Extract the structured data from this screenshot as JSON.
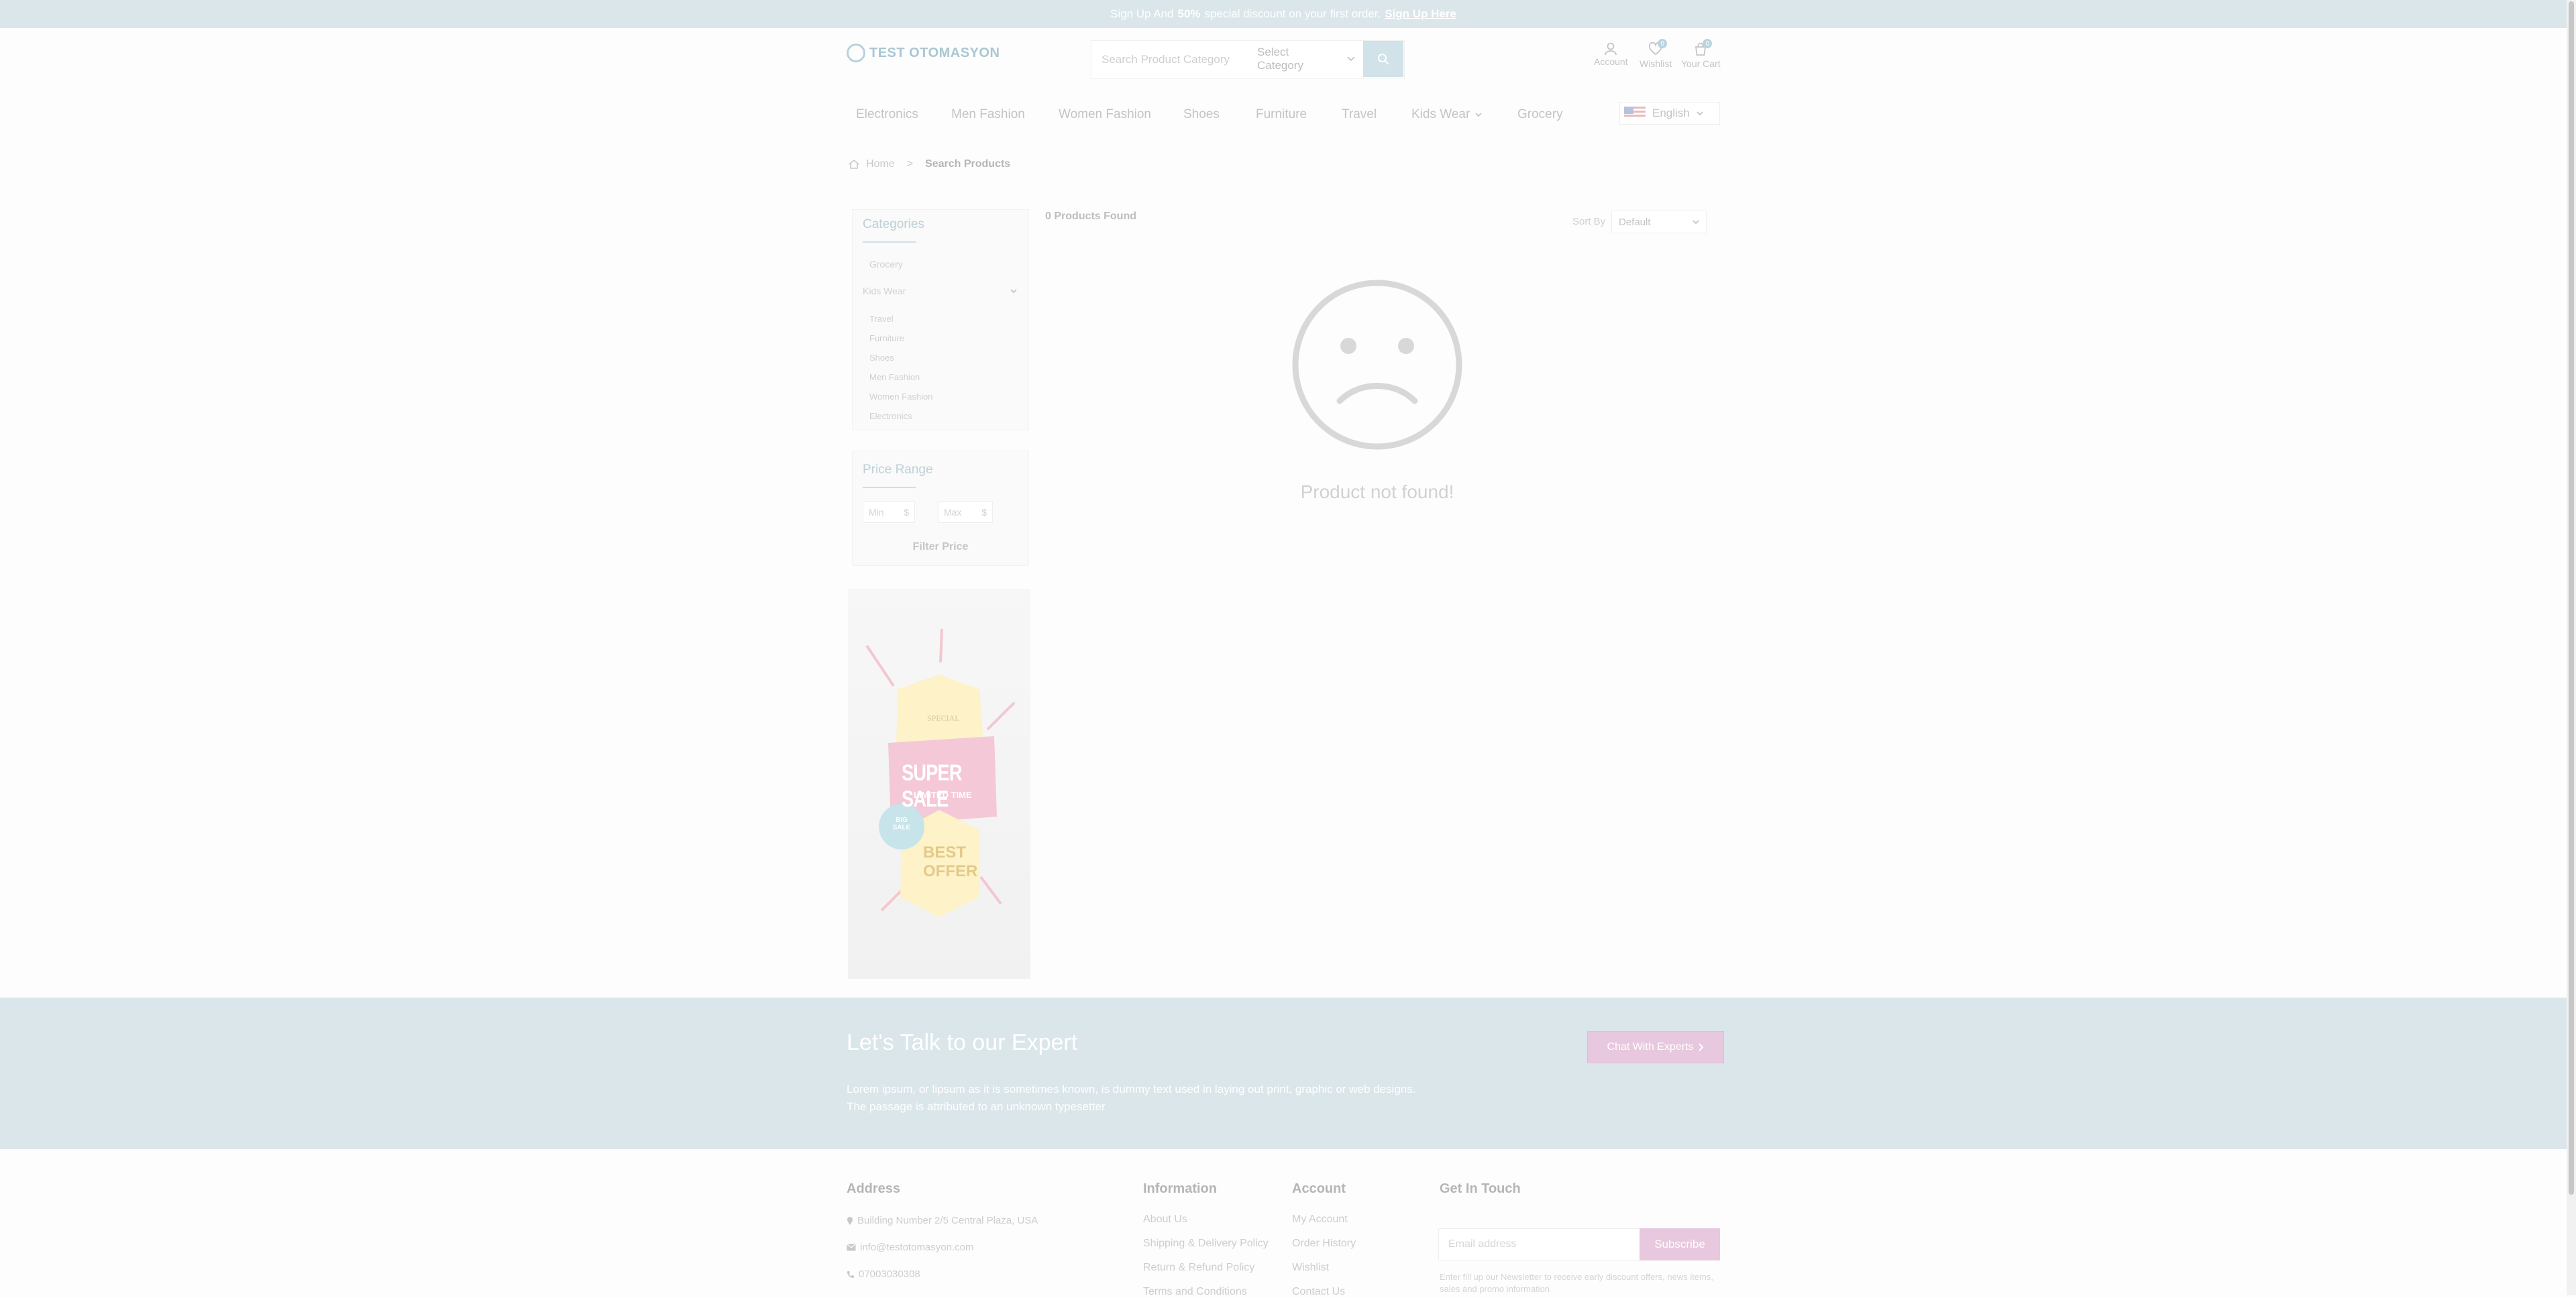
{
  "topbar": {
    "text_before": "Sign Up And",
    "discount": "50%",
    "text_after": "special discount on your first order.",
    "link": "Sign Up Here"
  },
  "header": {
    "logo_text": "TEST OTOMASYON",
    "search_placeholder": "Search Product Category",
    "category_select": "Select Category",
    "account_label": "Account",
    "wishlist_label": "Wishlist",
    "wishlist_count": "0",
    "cart_label": "Your Cart",
    "cart_count": "0"
  },
  "nav": {
    "items": [
      "Electronics",
      "Men Fashion",
      "Women Fashion",
      "Shoes",
      "Furniture",
      "Travel",
      "Kids Wear",
      "Grocery"
    ],
    "language": "English"
  },
  "breadcrumb": {
    "home": "Home",
    "separator": ">",
    "current": "Search Products"
  },
  "sidebar": {
    "categories_title": "Categories",
    "categories": [
      "Grocery",
      "Kids Wear",
      "Travel",
      "Furniture",
      "Shoes",
      "Men Fashion",
      "Women Fashion",
      "Electronics"
    ],
    "price_title": "Price Range",
    "min_label": "Min",
    "max_label": "Max",
    "currency": "$",
    "filter_button": "Filter Price"
  },
  "banner": {
    "top_text": "SPECIAL",
    "sale_text": "SUPER SALE",
    "limited_text": "LIMITED TIME",
    "offer_text": "BEST OFFER",
    "badge_text": "BIG SALE"
  },
  "results": {
    "count_text": "0 Products Found",
    "sort_label": "Sort By",
    "sort_value": "Default",
    "empty_message": "Product not found!"
  },
  "expert": {
    "title": "Let's Talk to our Expert",
    "text": "Lorem ipsum, or lipsum as it is sometimes known, is dummy text used in laying out print, graphic or web designs. The passage is attributed to an unknown typesetter",
    "button": "Chat With Experts"
  },
  "footer": {
    "address_title": "Address",
    "address": "Building Number 2/5 Central Plaza, USA",
    "email": "info@testotomasyon.com",
    "phone": "07003030308",
    "information_title": "Information",
    "information_links": [
      "About Us",
      "Shipping & Delivery Policy",
      "Return & Refund Policy",
      "Terms and Conditions"
    ],
    "account_title": "Account",
    "account_links": [
      "My Account",
      "Order History",
      "Wishlist",
      "Contact Us"
    ],
    "touch_title": "Get In Touch",
    "email_placeholder": "Email address",
    "subscribe_button": "Subscribe",
    "subscribe_note": "Enter fill up our Newsletter to receive early discount offers, news items, sales and promo information"
  },
  "colors": {
    "accent": "#dbe6ea",
    "button_pink": "#e8c8de",
    "overlay": "#fdfdfd"
  }
}
